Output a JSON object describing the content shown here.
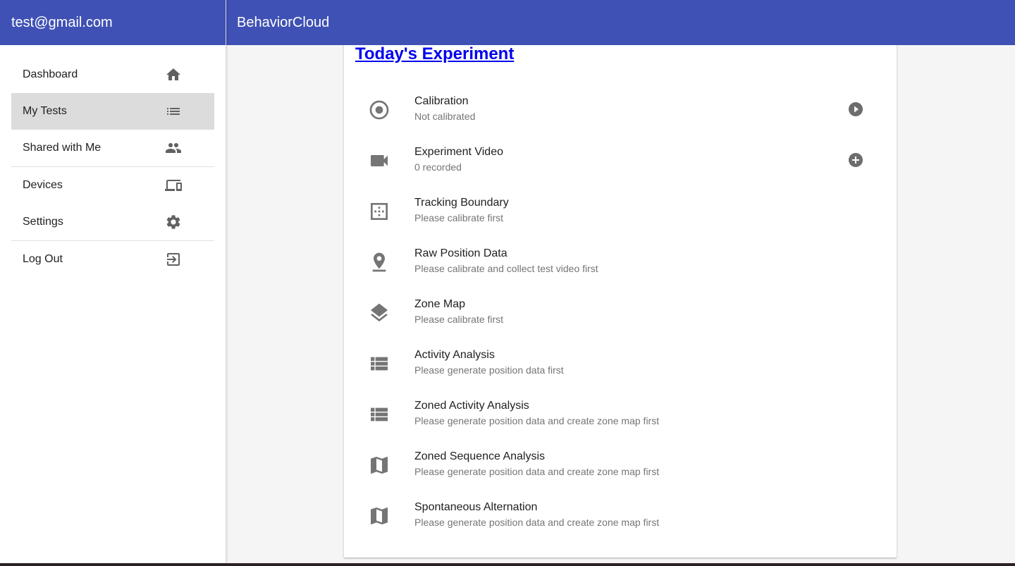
{
  "sidebar": {
    "account_email": "test@gmail.com",
    "items": [
      {
        "label": "Dashboard",
        "icon": "home-icon"
      },
      {
        "label": "My Tests",
        "icon": "list-icon",
        "active": true
      },
      {
        "label": "Shared with Me",
        "icon": "people-icon"
      },
      {
        "label": "Devices",
        "icon": "devices-icon"
      },
      {
        "label": "Settings",
        "icon": "gear-icon"
      },
      {
        "label": "Log Out",
        "icon": "exit-icon"
      }
    ]
  },
  "header": {
    "app_title": "BehaviorCloud"
  },
  "main": {
    "card_title": "Today's Experiment",
    "steps": [
      {
        "title": "Calibration",
        "status": "Not calibrated",
        "icon": "target-icon",
        "action": "play-icon"
      },
      {
        "title": "Experiment Video",
        "status": "0 recorded",
        "icon": "video-camera-icon",
        "action": "add-icon"
      },
      {
        "title": "Tracking Boundary",
        "status": "Please calibrate first",
        "icon": "boundary-icon"
      },
      {
        "title": "Raw Position Data",
        "status": "Please calibrate and collect test video first",
        "icon": "location-pin-icon"
      },
      {
        "title": "Zone Map",
        "status": "Please calibrate first",
        "icon": "layers-icon"
      },
      {
        "title": "Activity Analysis",
        "status": "Please generate position data first",
        "icon": "table-list-icon"
      },
      {
        "title": "Zoned Activity Analysis",
        "status": "Please generate position data and create zone map first",
        "icon": "table-list-icon"
      },
      {
        "title": "Zoned Sequence Analysis",
        "status": "Please generate position data and create zone map first",
        "icon": "map-icon"
      },
      {
        "title": "Spontaneous Alternation",
        "status": "Please generate position data and create zone map first",
        "icon": "map-icon"
      }
    ]
  },
  "colors": {
    "primary": "#3f51b5",
    "active_item_bg": "#dcdcdc",
    "link": "#0000ee",
    "icon": "#757575"
  }
}
